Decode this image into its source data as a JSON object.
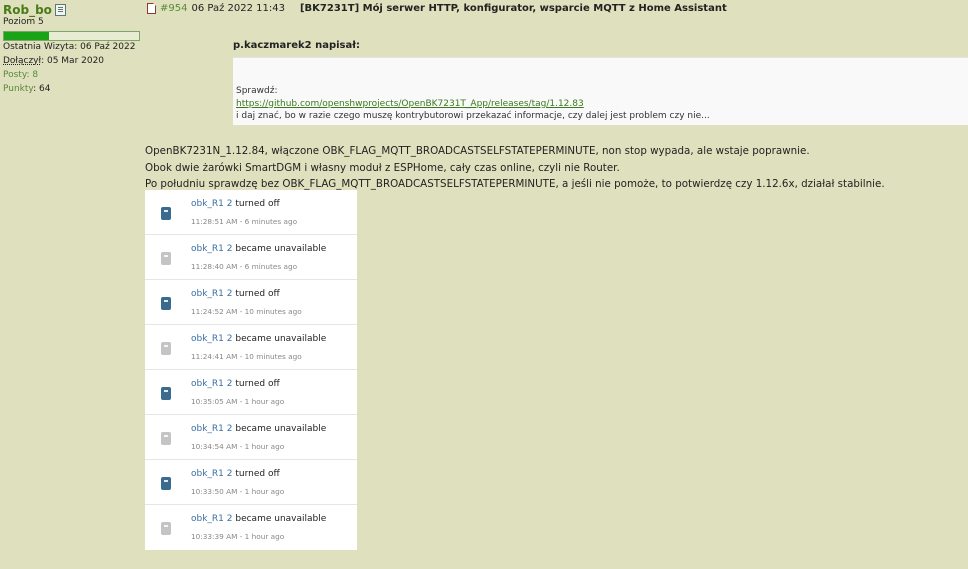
{
  "user": {
    "name": "Rob_bo",
    "rank": "Poziom 5",
    "rank_progress": 0.33,
    "last_visit": "Ostatnia Wizyta: 06 Paź 2022",
    "joined_label": "Dołączył",
    "joined_value": ": 05 Mar 2020",
    "posts_label": "Posty",
    "posts_value": ": 8",
    "points_label": "Punkty",
    "points_value": ": 64"
  },
  "post": {
    "number": "#954",
    "date": "06 Paź 2022 11:43",
    "title": "[BK7231T] Mój serwer HTTP, konfigurator, wsparcie MQTT z Home Assistant"
  },
  "quote": {
    "author": "p.kaczmarek2 napisał:",
    "line1": "Sprawdź:",
    "link": "https://github.com/openshwprojects/OpenBK7231T_App/releases/tag/1.12.83",
    "line3": "i daj znać, bo w razie czego muszę kontrybutorowi przekazać informacje, czy dalej jest problem czy nie..."
  },
  "body": {
    "line1": "OpenBK7231N_1.12.84, włączone OBK_FLAG_MQTT_BROADCASTSELFSTATEPERMINUTE, non stop wypada, ale wstaje poprawnie.",
    "line2": "Obok dwie żarówki SmartDGM i własny moduł z ESPHome, cały czas online, czyli nie Router.",
    "line3": "Po południu sprawdzę bez OBK_FLAG_MQTT_BROADCASTSELFSTATEPERMINUTE, a jeśli nie pomoże, to potwierdzę czy 1.12.6x, działał stabilnie."
  },
  "history": [
    {
      "name": "obk_R1 2",
      "action": " turned off",
      "time": "11:28:51 AM - 6 minutes ago",
      "icon": "switch-icon",
      "state": "on"
    },
    {
      "name": "obk_R1 2",
      "action": " became unavailable",
      "time": "11:28:40 AM - 6 minutes ago",
      "icon": "switch-icon",
      "state": "off"
    },
    {
      "name": "obk_R1 2",
      "action": " turned off",
      "time": "11:24:52 AM - 10 minutes ago",
      "icon": "switch-icon",
      "state": "on"
    },
    {
      "name": "obk_R1 2",
      "action": " became unavailable",
      "time": "11:24:41 AM - 10 minutes ago",
      "icon": "switch-icon",
      "state": "off"
    },
    {
      "name": "obk_R1 2",
      "action": " turned off",
      "time": "10:35:05 AM - 1 hour ago",
      "icon": "switch-icon",
      "state": "on"
    },
    {
      "name": "obk_R1 2",
      "action": " became unavailable",
      "time": "10:34:54 AM - 1 hour ago",
      "icon": "switch-icon",
      "state": "off"
    },
    {
      "name": "obk_R1 2",
      "action": " turned off",
      "time": "10:33:50 AM - 1 hour ago",
      "icon": "switch-icon",
      "state": "on"
    },
    {
      "name": "obk_R1 2",
      "action": " became unavailable",
      "time": "10:33:39 AM - 1 hour ago",
      "icon": "switch-icon",
      "state": "off"
    }
  ],
  "colors": {
    "background": "#dfe0bd",
    "username": "#4b7a1a",
    "link": "#3a7a1a",
    "rank_fill": "#19a319",
    "entity": "#3a6ea5",
    "icon_on": "#3a6b8f",
    "icon_off": "#c4c4c4"
  }
}
